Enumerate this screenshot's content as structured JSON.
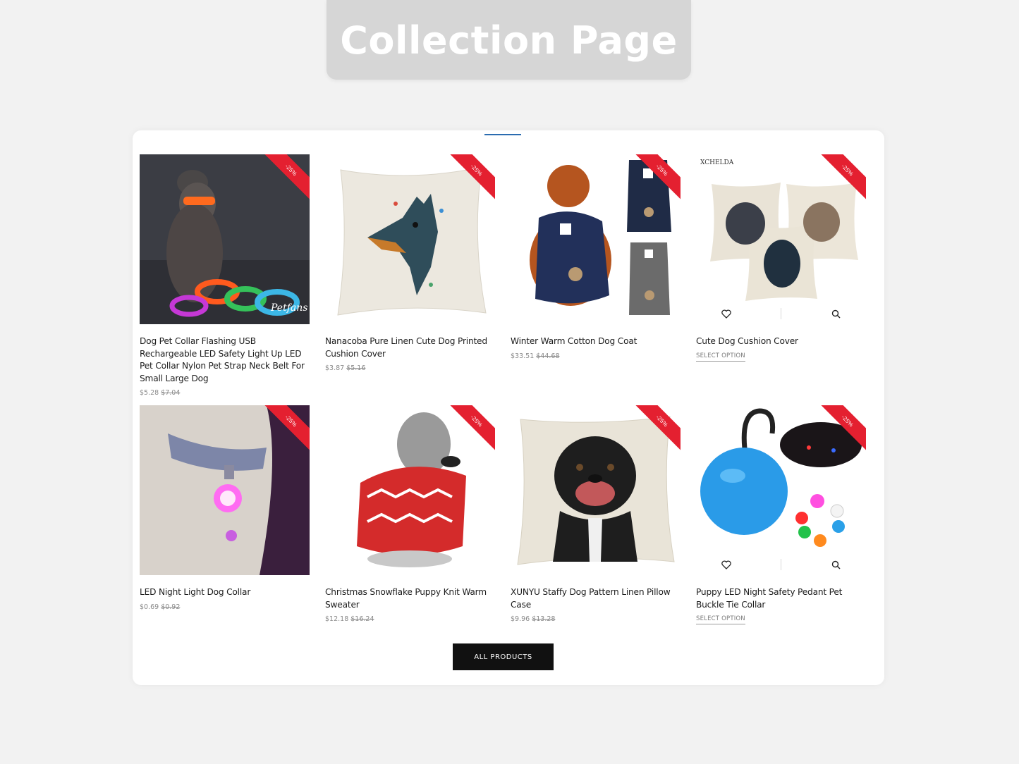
{
  "banner": {
    "title": "Collection Page"
  },
  "colors": {
    "ribbon": "#e42030",
    "button": "#111111",
    "accent": "#2b6cb0"
  },
  "products": [
    {
      "title": "Dog Pet Collar Flashing USB Rechargeable LED Safety Light Up LED Pet Collar Nylon Pet Strap Neck Belt For Small Large Dog",
      "price": "$5.28",
      "old_price": "$7.04",
      "badge": "-25%",
      "image_text": "Petfans"
    },
    {
      "title": "Nanacoba Pure Linen Cute Dog Printed Cushion Cover",
      "price": "$3.87",
      "old_price": "$5.16",
      "badge": "-25%"
    },
    {
      "title": "Winter Warm Cotton Dog Coat",
      "price": "$33.51",
      "old_price": "$44.68",
      "badge": "-25%"
    },
    {
      "title": "Cute Dog Cushion Cover",
      "select_label": "SELECT OPTION",
      "badge": "-25%",
      "image_text": "XCHELDA"
    },
    {
      "title": "LED Night Light Dog Collar",
      "price": "$0.69",
      "old_price": "$0.92",
      "badge": "-25%"
    },
    {
      "title": "Christmas Snowflake Puppy Knit Warm Sweater",
      "price": "$12.18",
      "old_price": "$16.24",
      "badge": "-25%"
    },
    {
      "title": "XUNYU Staffy Dog Pattern Linen Pillow Case",
      "price": "$9.96",
      "old_price": "$13.28",
      "badge": "-25%"
    },
    {
      "title": "Puppy LED Night Safety Pedant Pet Buckle Tie Collar",
      "select_label": "SELECT OPTION",
      "badge": "-25%"
    }
  ],
  "all_products_label": "ALL PRODUCTS"
}
